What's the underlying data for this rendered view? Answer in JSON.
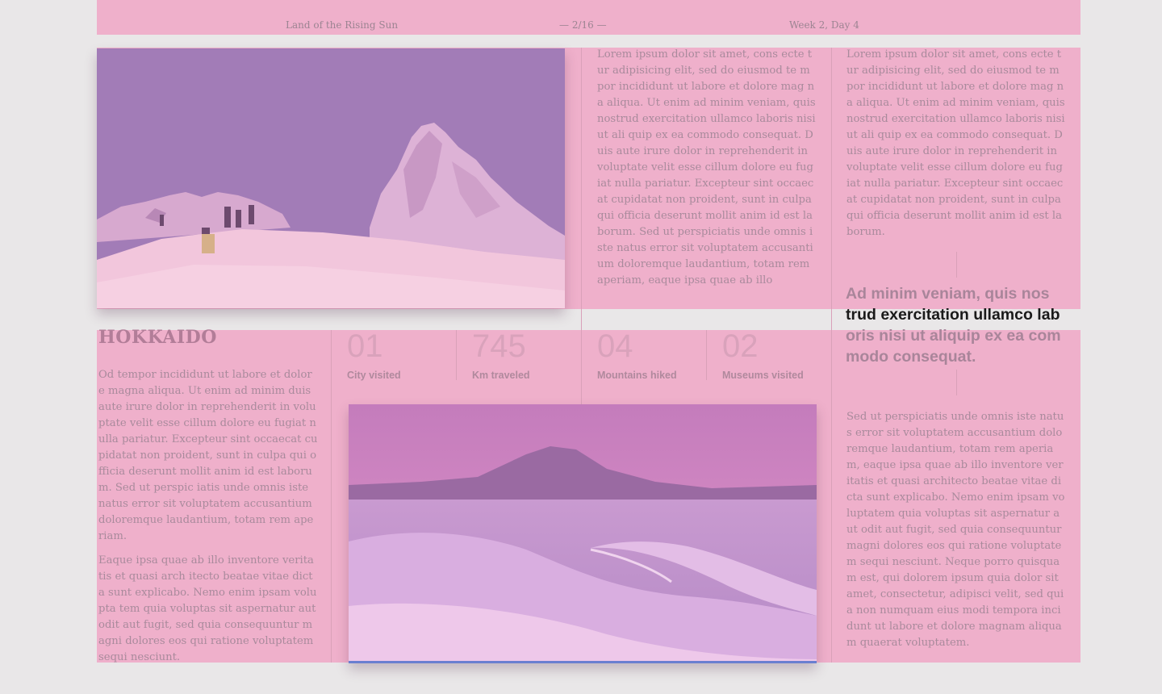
{
  "header": {
    "left": "Land of the Rising Sun",
    "center": "— 2/16 —",
    "right": "Week 2, Day 4"
  },
  "column_mid": {
    "text": "Lorem ipsum dolor sit amet, cons ecte tur adipisicing elit, sed do eiusmod te mpor incididunt ut labore et dolore mag na aliqua. Ut enim ad minim veniam, quis nostrud exercitation ullamco laboris nisi ut ali quip ex ea commodo consequat. Duis aute irure dolor in reprehenderit in voluptate velit esse cillum dolore eu fugiat nulla pariatur. Excepteur sint occaecat cupidatat non proident, sunt in culpa qui officia deserunt mollit anim id est laborum. Sed ut perspiciatis unde omnis iste natus error sit voluptatem accusantium doloremque laudantium, totam rem aperiam, eaque ipsa quae ab illo"
  },
  "column_right": {
    "text_top": "Lorem ipsum dolor sit amet, cons ecte tur adipisicing elit, sed do eiusmod te mpor incididunt ut labore et dolore mag na aliqua. Ut enim ad minim veniam, quis nostrud exercitation ullamco laboris nisi ut ali quip ex ea commodo consequat. Duis aute irure dolor in reprehenderit in voluptate velit esse cillum dolore eu fugiat nulla pariatur. Excepteur sint occaecat cupidatat non proident, sunt in culpa qui officia deserunt mollit anim id est laborum.",
    "quote_part1": "Ad minim veniam, quis nos",
    "quote_part2": "trud exercitation ullamco lab",
    "quote_part3": "oris nisi ut aliquip ex ea com modo consequat.",
    "text_bottom": "Sed ut perspiciatis unde omnis iste natus error sit voluptatem accusantium doloremque laudantium, totam rem aperiam, eaque ipsa quae ab illo inventore veritatis et quasi architecto beatae vitae dicta sunt explicabo. Nemo enim ipsam voluptatem quia voluptas sit aspernatur aut odit aut fugit, sed quia consequuntur magni dolores eos qui ratione voluptatem sequi nesciunt. Neque porro quisquam est, qui dolorem ipsum quia dolor sit amet, consectetur, adipisci velit, sed quia non numquam eius modi tempora incidunt ut labore et dolore magnam aliquam quaerat voluptatem."
  },
  "article": {
    "title": "HOKKAIDO",
    "para1": "Od tempor incididunt ut labore et dolore magna aliqua. Ut enim ad minim duis aute irure dolor in reprehenderit in voluptate velit esse cillum dolore eu fugiat nulla pariatur. Excepteur sint occaecat cupidatat non proident, sunt in culpa qui officia deserunt mollit anim id est laborum. Sed ut perspic iatis unde omnis iste natus error sit voluptatem accusantium doloremque laudantium, totam rem aperiam.",
    "para2": "Eaque ipsa quae ab illo inventore veritatis et quasi arch itecto beatae vitae dicta sunt explicabo. Nemo enim ipsam volupta tem quia voluptas sit aspernatur aut odit aut fugit, sed quia consequuntur magni dolores eos qui ratione voluptatem sequi nesciunt."
  },
  "stats": [
    {
      "value": "01",
      "label": "City visited"
    },
    {
      "value": "745",
      "label": "Km traveled"
    },
    {
      "value": "04",
      "label": "Mountains hiked"
    },
    {
      "value": "02",
      "label": "Museums visited"
    }
  ],
  "colors": {
    "overlay_pink": "#efb0cb",
    "page_bg": "#e9e7e8",
    "text_muted": "#a98a9c",
    "quote_dark": "#1a1a1a"
  }
}
